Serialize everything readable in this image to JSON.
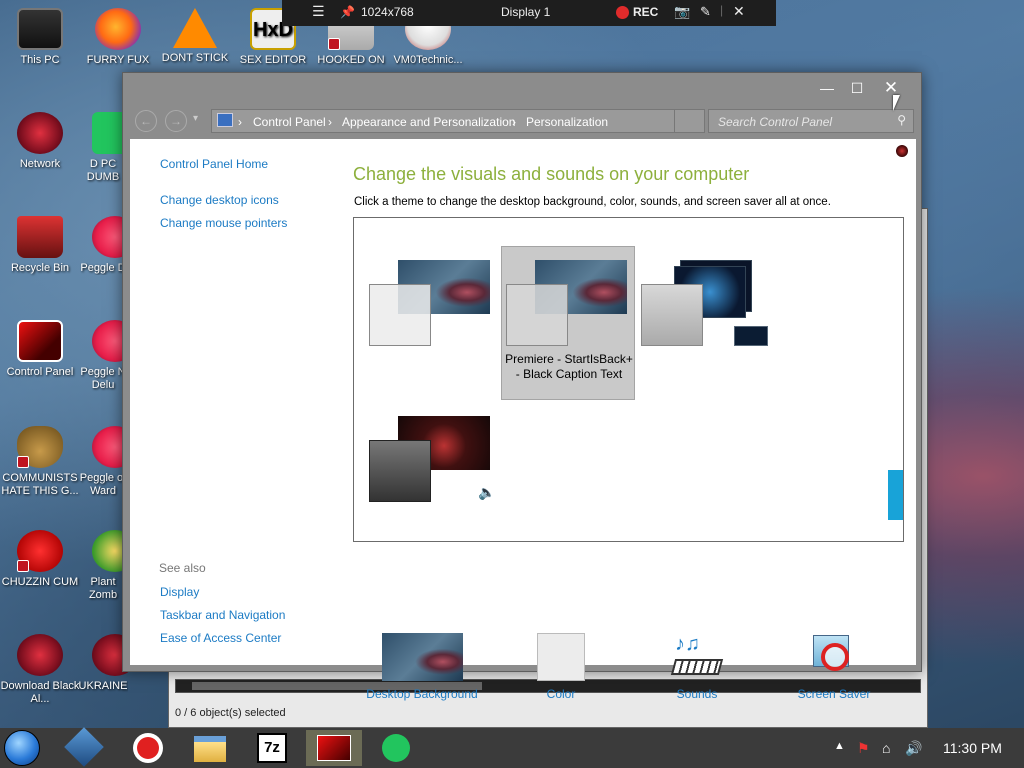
{
  "desktop_icons": [
    {
      "label": "This PC"
    },
    {
      "label": "FURRY FUX"
    },
    {
      "label": "DONT STICK"
    },
    {
      "label": "SEX EDITOR"
    },
    {
      "label": "HOOKED ON"
    },
    {
      "label": "VM0Technic..."
    },
    {
      "label": "Network"
    },
    {
      "label": "D PC DUMB"
    },
    {
      "label": "Recycle Bin"
    },
    {
      "label": "Peggle D"
    },
    {
      "label": "Control Panel"
    },
    {
      "label": "Peggle N Delu"
    },
    {
      "label": "COMMUNISTS HATE THIS G..."
    },
    {
      "label": "Peggle of Ward"
    },
    {
      "label": "CHUZZIN CUM"
    },
    {
      "label": "Plant Zomb"
    },
    {
      "label": "Download Black Al..."
    },
    {
      "label": "UKRAINE"
    }
  ],
  "recorder": {
    "resolution": "1024x768",
    "display": "Display 1",
    "rec_label": "REC",
    "rec_color": "#e02b2b"
  },
  "window": {
    "breadcrumbs": [
      "Control Panel",
      "Appearance and Personalization",
      "Personalization"
    ],
    "search_placeholder": "Search Control Panel",
    "sidebar_links": [
      "Control Panel Home",
      "Change desktop icons",
      "Change mouse pointers"
    ],
    "see_also_label": "See also",
    "see_also_links": [
      "Display",
      "Taskbar and Navigation",
      "Ease of Access Center"
    ],
    "heading": "Change the visuals and sounds on your computer",
    "subtitle": "Click a theme to change the desktop background, color, sounds, and screen saver all at once.",
    "selected_theme_label": "Premiere - StartIsBack+ - Black Caption Text",
    "bottom_items": [
      "Desktop Background",
      "Color",
      "Sounds",
      "Screen Saver"
    ],
    "heading_color": "#8db03d",
    "link_color": "#1c7bc4"
  },
  "behind_window": {
    "status": "0 / 6 object(s) selected"
  },
  "taskbar": {
    "clock": "11:30 PM"
  }
}
